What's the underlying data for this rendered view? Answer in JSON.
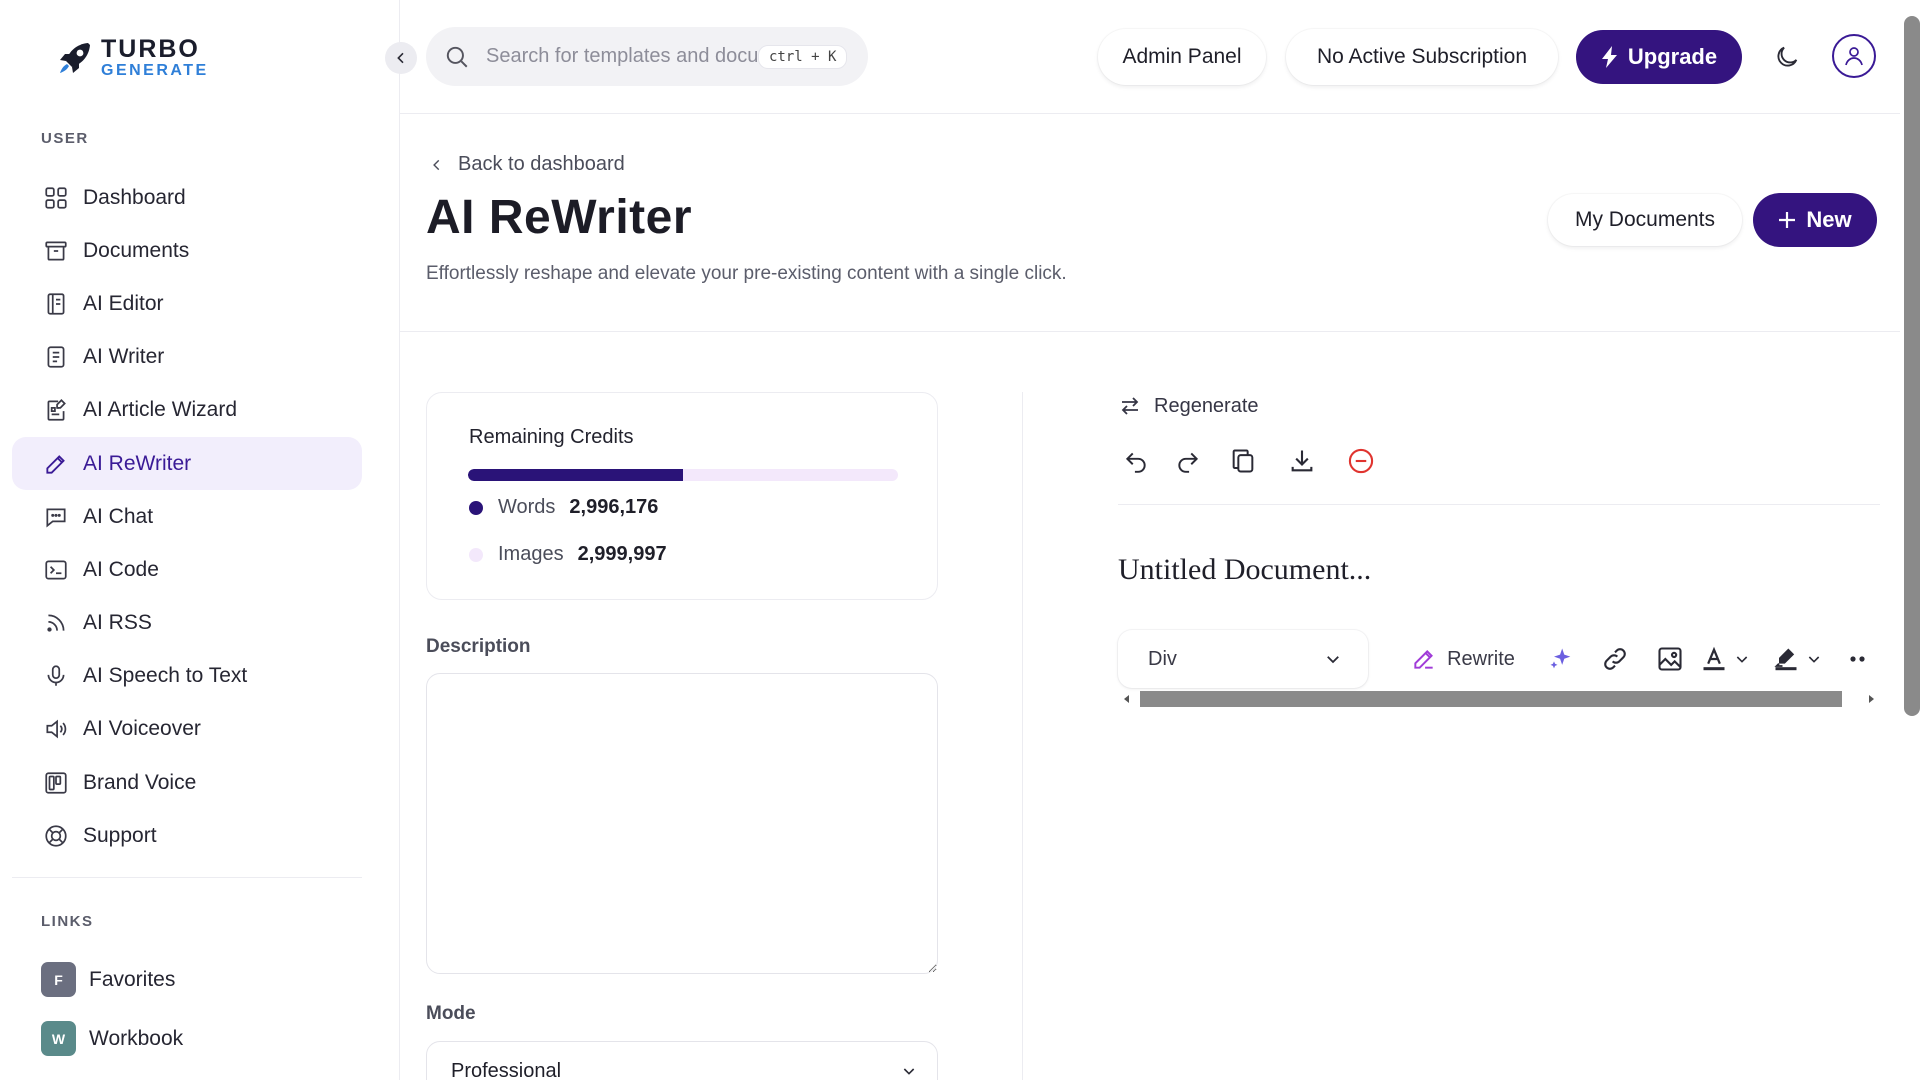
{
  "app": {
    "logo_line1": "TURBO",
    "logo_line2": "GENERATE"
  },
  "sidebar": {
    "section_user": "USER",
    "items": [
      {
        "label": "Dashboard",
        "icon": "grid-icon"
      },
      {
        "label": "Documents",
        "icon": "archive-icon"
      },
      {
        "label": "AI Editor",
        "icon": "notebook-icon"
      },
      {
        "label": "AI Writer",
        "icon": "document-icon"
      },
      {
        "label": "AI Article Wizard",
        "icon": "article-edit-icon"
      },
      {
        "label": "AI ReWriter",
        "icon": "pencil-icon",
        "active": true
      },
      {
        "label": "AI Chat",
        "icon": "chat-icon"
      },
      {
        "label": "AI Code",
        "icon": "terminal-icon"
      },
      {
        "label": "AI RSS",
        "icon": "rss-icon"
      },
      {
        "label": "AI Speech to Text",
        "icon": "microphone-icon"
      },
      {
        "label": "AI Voiceover",
        "icon": "speaker-icon"
      },
      {
        "label": "Brand Voice",
        "icon": "board-icon"
      },
      {
        "label": "Support",
        "icon": "lifebuoy-icon"
      }
    ],
    "section_links": "LINKS",
    "links": [
      {
        "label": "Favorites",
        "badge": "F",
        "color": "#6b6f80"
      },
      {
        "label": "Workbook",
        "badge": "W",
        "color": "#5a8a8a"
      }
    ]
  },
  "header": {
    "search_placeholder": "Search for templates and documents...",
    "search_shortcut": "ctrl + K",
    "admin_panel": "Admin Panel",
    "subscription": "No Active Subscription",
    "upgrade": "Upgrade"
  },
  "page": {
    "back": "Back to dashboard",
    "title": "AI ReWriter",
    "subtitle": "Effortlessly reshape and elevate your pre-existing content with a single click.",
    "my_documents": "My Documents",
    "new": "New"
  },
  "credits": {
    "title": "Remaining Credits",
    "words_label": "Words",
    "words_value": "2,996,176",
    "images_label": "Images",
    "images_value": "2,999,997",
    "words_share": 0.5
  },
  "form": {
    "description_label": "Description",
    "mode_label": "Mode",
    "mode_value": "Professional"
  },
  "editor": {
    "regenerate": "Regenerate",
    "doc_title": "Untitled Document...",
    "block_type": "Div",
    "rewrite": "Rewrite"
  },
  "colors": {
    "primary": "#34147f",
    "accent_blue": "#2f7fd8",
    "active_bg": "#f2eefc",
    "danger": "#e0342f",
    "progress_track": "#f3e8fb",
    "rewrite_icon": "#a03bd8",
    "sparkle_icon": "#6b5fe0"
  }
}
